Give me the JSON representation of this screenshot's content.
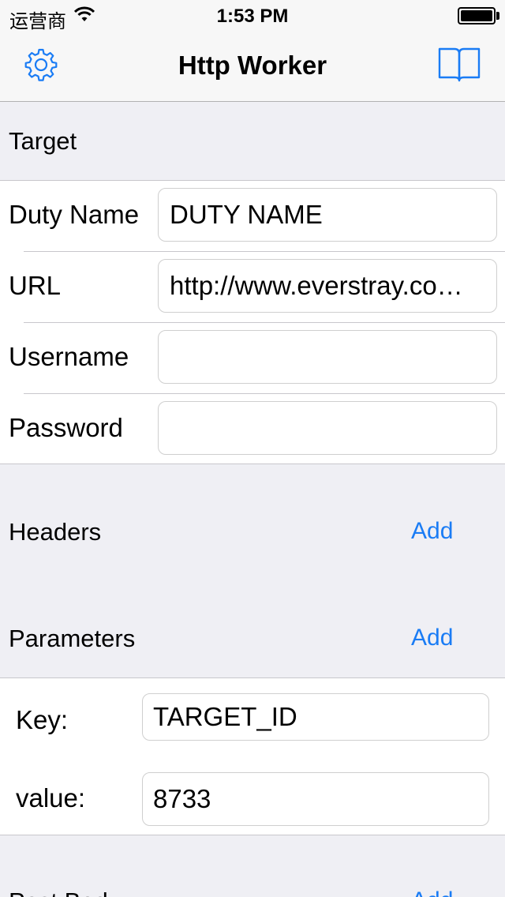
{
  "status_bar": {
    "carrier": "运营商",
    "time": "1:53 PM",
    "battery_level": 1.0
  },
  "nav": {
    "title": "Http Worker",
    "left_icon": "gear-icon",
    "right_icon": "book-icon",
    "accent_color": "#1a7cf5"
  },
  "target_section": {
    "header": "Target",
    "rows": [
      {
        "label": "Duty Name",
        "value": "DUTY NAME"
      },
      {
        "label": "URL",
        "value": "http://www.everstray.co…"
      },
      {
        "label": "Username",
        "value": ""
      },
      {
        "label": "Password",
        "value": ""
      }
    ]
  },
  "headers_section": {
    "header": "Headers",
    "add_label": "Add"
  },
  "parameters_section": {
    "header": "Parameters",
    "add_label": "Add",
    "key_label": "Key:",
    "key_value": "TARGET_ID",
    "value_label": "value:",
    "value_value": "8733"
  },
  "post_body_section": {
    "header": "Post Body",
    "add_label": "Add"
  }
}
